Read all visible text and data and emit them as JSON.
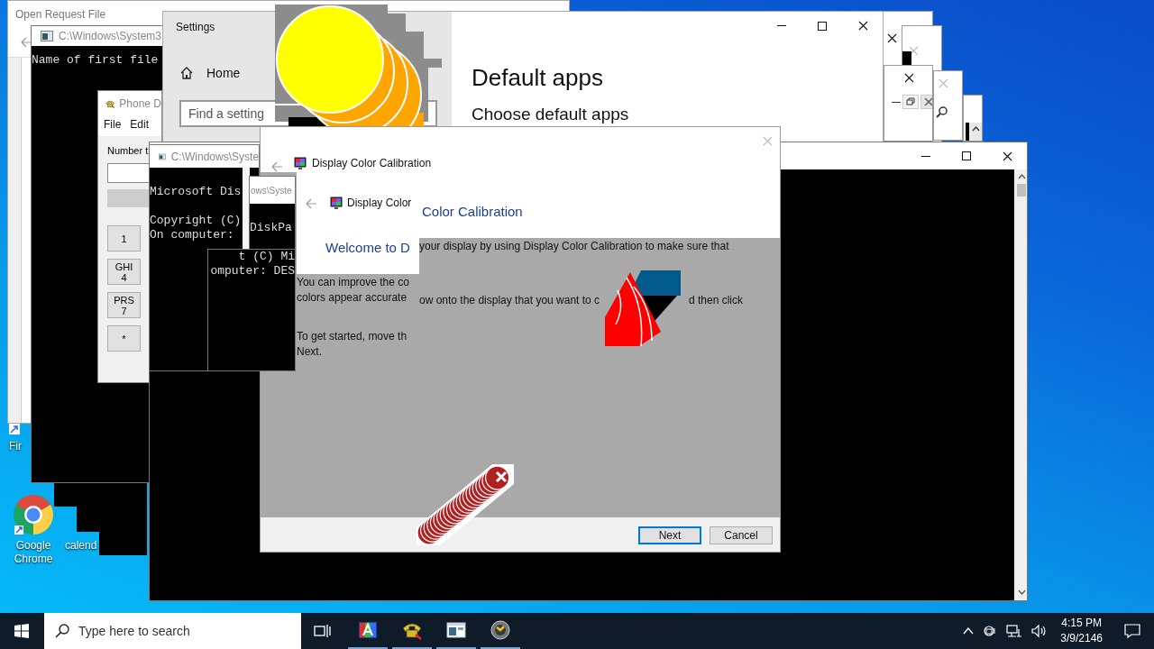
{
  "desktop": {
    "icons": [
      {
        "label": "Fir",
        "kind": "firefox"
      },
      {
        "label": "Google Chrome",
        "kind": "chrome"
      },
      {
        "label": "calend",
        "kind": "hidden"
      }
    ]
  },
  "layers": [
    {
      "kind": "dialog",
      "title": "Open Request File"
    },
    {
      "kind": "frame"
    },
    {
      "kind": "frame"
    },
    {
      "kind": "frame"
    },
    {
      "kind": "frame"
    },
    {
      "kind": "frame"
    },
    {
      "kind": "console",
      "title": "C:\\Windows\\System3",
      "lines": [
        "Name of first file"
      ]
    },
    {
      "kind": "settings",
      "title": "Settings",
      "nav": [
        {
          "label": "Home"
        }
      ],
      "search": {
        "placeholder": "Find a setting"
      },
      "heading": "Default apps",
      "subheading": "Choose default apps"
    },
    {
      "kind": "circles"
    },
    {
      "kind": "dialer",
      "title": "Phone D",
      "menu": [
        "File",
        "Edit"
      ],
      "field_label": "Number t",
      "keys": [
        "1",
        "GHI\n4",
        "PRS\n7",
        "*"
      ]
    },
    {
      "kind": "console"
    },
    {
      "kind": "console",
      "title": "C:\\Windows\\Syste",
      "lines": [
        "Microsoft Dis",
        "Copyright (C)",
        "On computer:"
      ]
    },
    {
      "kind": "calibration",
      "title": "Display Color Calibration",
      "panels": [
        {
          "title": "Display Color",
          "heading": "Welcome to D"
        },
        {
          "heading": "Color Calibration"
        }
      ],
      "text_fragments": [
        "your display by using Display Color Calibration to make sure that",
        "ow onto the display that you want to c",
        "d then click",
        "You can improve the co",
        "colors appear accurate",
        "To get started, move th",
        "Next."
      ],
      "buttons": [
        {
          "label": "Next",
          "default": true
        },
        {
          "label": "Cancel",
          "default": false
        }
      ]
    },
    {
      "kind": "console",
      "title": "ows\\Syste",
      "lines": [
        "DiskPa"
      ]
    },
    {
      "kind": "console",
      "lines": [
        "t (C) Mi",
        "omputer: DES"
      ]
    },
    {
      "kind": "wedge"
    },
    {
      "kind": "error_stack"
    }
  ],
  "taskbar": {
    "search": {
      "placeholder": "Type here to search"
    },
    "apps": [
      {
        "kind": "paint",
        "running": true
      },
      {
        "kind": "phone",
        "running": true
      },
      {
        "kind": "window",
        "running": true
      },
      {
        "kind": "disc",
        "running": true
      }
    ],
    "clock": {
      "time": "4:15 PM",
      "date": "3/9/2146"
    }
  }
}
